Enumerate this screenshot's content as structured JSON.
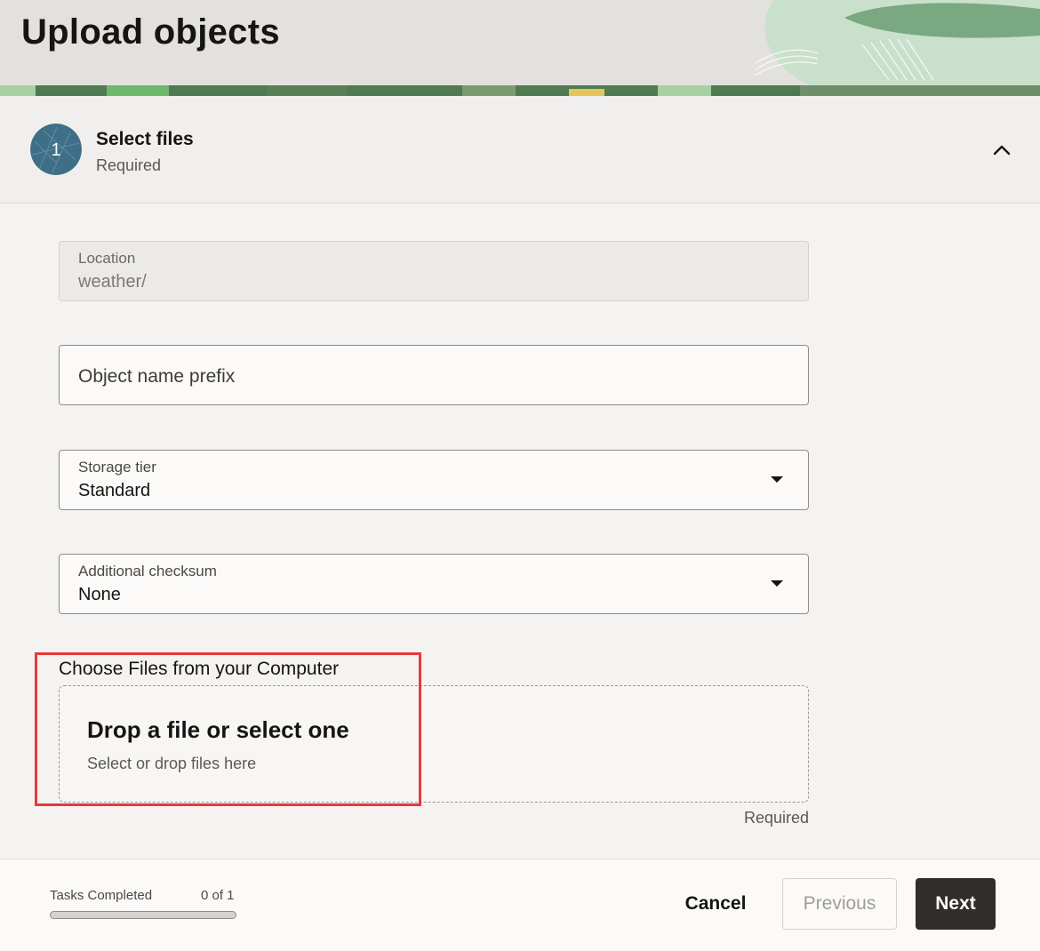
{
  "header": {
    "title": "Upload objects"
  },
  "step": {
    "number": "1",
    "title": "Select files",
    "subtitle": "Required"
  },
  "form": {
    "location": {
      "label": "Location",
      "value": "weather/"
    },
    "object_prefix": {
      "placeholder": "Object name prefix"
    },
    "storage_tier": {
      "label": "Storage tier",
      "value": "Standard"
    },
    "checksum": {
      "label": "Additional checksum",
      "value": "None"
    },
    "files": {
      "label": "Choose Files from your Computer",
      "drop_title": "Drop a file or select one",
      "drop_subtitle": "Select or drop files here",
      "required_note": "Required"
    }
  },
  "footer": {
    "tasks_label": "Tasks Completed",
    "tasks_count": "0 of 1",
    "progress": 0,
    "cancel_label": "Cancel",
    "previous_label": "Previous",
    "next_label": "Next"
  },
  "colors": {
    "highlight": "#e8383c",
    "primary_button": "#312d2a",
    "step_badge": "#3e6f87"
  }
}
